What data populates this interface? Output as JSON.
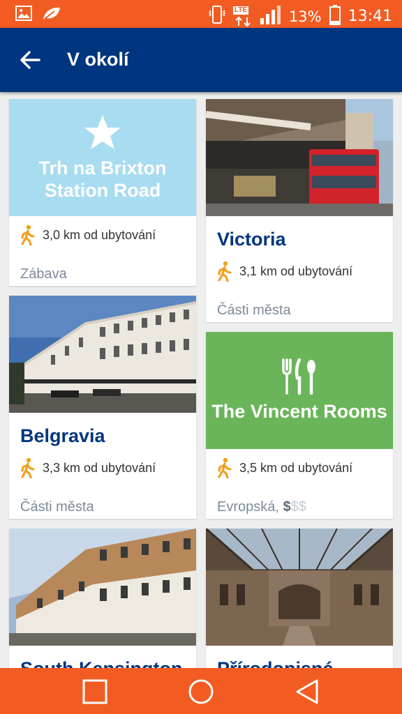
{
  "status": {
    "network": "LTE",
    "battery": "13%",
    "time": "13:41"
  },
  "header": {
    "title": "V okolí"
  },
  "cards": [
    {
      "title": "Trh na Brixton Station Road",
      "distance": "3,0 km od ubytování",
      "category": "Zábava",
      "media": "star-icon"
    },
    {
      "title": "Victoria",
      "distance": "3,1 km od ubytování",
      "category": "Části města",
      "media": "photo-victoria-station"
    },
    {
      "title": "Belgravia",
      "distance": "3,3 km od ubytování",
      "category": "Části města",
      "media": "photo-belgravia"
    },
    {
      "title": "The Vincent Rooms",
      "distance": "3,5 km od ubytování",
      "category_main": "Evropská,",
      "price_active": "$",
      "price_inactive": "$$",
      "media": "fork-knife-spoon-icon"
    },
    {
      "title": "South Kensington",
      "media": "photo-south-kensington"
    },
    {
      "title": "Přírodopisné",
      "media": "photo-natural-history-museum"
    }
  ],
  "colors": {
    "statusbar": "#f25c22",
    "appbar": "#003580",
    "tile_blue": "#a8dcf0",
    "tile_green": "#6ab55a",
    "walk_icon": "#f0a020",
    "navbar": "#f25c22"
  }
}
